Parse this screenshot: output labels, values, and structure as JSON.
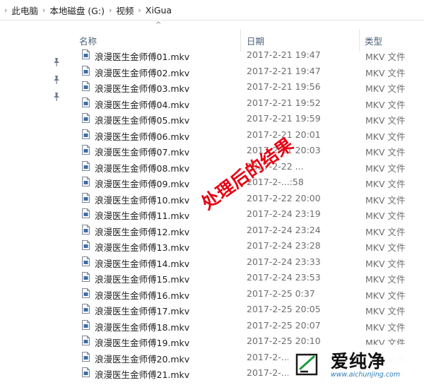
{
  "breadcrumb": {
    "items": [
      "此电脑",
      "本地磁盘 (G:)",
      "视频",
      "XiGua"
    ]
  },
  "columns": {
    "name": "名称",
    "date": "日期",
    "type": "类型"
  },
  "files": [
    {
      "name": "浪漫医生金师傅01.mkv",
      "date": "2017-2-21 19:47",
      "type": "MKV 文件"
    },
    {
      "name": "浪漫医生金师傅02.mkv",
      "date": "2017-2-21 19:47",
      "type": "MKV 文件"
    },
    {
      "name": "浪漫医生金师傅03.mkv",
      "date": "2017-2-21 19:56",
      "type": "MKV 文件"
    },
    {
      "name": "浪漫医生金师傅04.mkv",
      "date": "2017-2-21 19:52",
      "type": "MKV 文件"
    },
    {
      "name": "浪漫医生金师傅05.mkv",
      "date": "2017-2-21 19:59",
      "type": "MKV 文件"
    },
    {
      "name": "浪漫医生金师傅06.mkv",
      "date": "2017-2-21 20:01",
      "type": "MKV 文件"
    },
    {
      "name": "浪漫医生金师傅07.mkv",
      "date": "2017-2-21 20:03",
      "type": "MKV 文件"
    },
    {
      "name": "浪漫医生金师傅08.mkv",
      "date": "2017-2-22 ...",
      "type": "MKV 文件"
    },
    {
      "name": "浪漫医生金师傅09.mkv",
      "date": "2017-2-...:58",
      "type": "MKV 文件"
    },
    {
      "name": "浪漫医生金师傅10.mkv",
      "date": "2017-2-22 20:00",
      "type": "MKV 文件"
    },
    {
      "name": "浪漫医生金师傅11.mkv",
      "date": "2017-2-24 23:19",
      "type": "MKV 文件"
    },
    {
      "name": "浪漫医生金师傅12.mkv",
      "date": "2017-2-24 23:24",
      "type": "MKV 文件"
    },
    {
      "name": "浪漫医生金师傅13.mkv",
      "date": "2017-2-24 23:28",
      "type": "MKV 文件"
    },
    {
      "name": "浪漫医生金师傅14.mkv",
      "date": "2017-2-24 23:33",
      "type": "MKV 文件"
    },
    {
      "name": "浪漫医生金师傅15.mkv",
      "date": "2017-2-24 23:53",
      "type": "MKV 文件"
    },
    {
      "name": "浪漫医生金师傅16.mkv",
      "date": "2017-2-25 0:37",
      "type": "MKV 文件"
    },
    {
      "name": "浪漫医生金师傅17.mkv",
      "date": "2017-2-25 20:05",
      "type": "MKV 文件"
    },
    {
      "name": "浪漫医生金师傅18.mkv",
      "date": "2017-2-25 20:07",
      "type": "MKV 文件"
    },
    {
      "name": "浪漫医生金师傅19.mkv",
      "date": "2017-2-25 20:10",
      "type": "MKV 文件"
    },
    {
      "name": "浪漫医生金师傅20.mkv",
      "date": "2017-2-...",
      "type": "MKV 文件"
    },
    {
      "name": "浪漫医生金师傅21.mkv",
      "date": "2017-2-...",
      "type": "MKV 文件"
    }
  ],
  "overlay_text": "处理后的结果",
  "watermark": {
    "brand": "爱纯净",
    "url": "www.aichunjing.com"
  },
  "colors": {
    "overlay": "#e60012",
    "header_text": "#4c607a",
    "watermark_logo": "#1a9b3c"
  }
}
